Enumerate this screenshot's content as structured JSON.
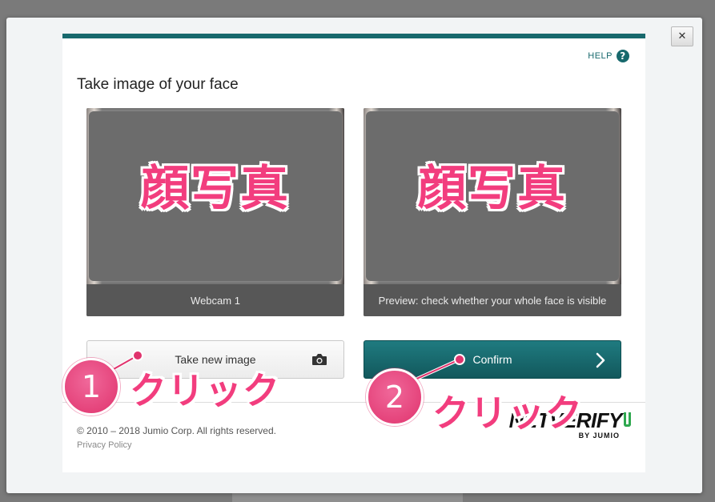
{
  "modal": {
    "close_label": "✕",
    "help_label": "HELP",
    "help_icon_label": "?",
    "title": "Take image of your face"
  },
  "frames": {
    "left": {
      "overlay_text": "顔写真",
      "caption": "Webcam 1"
    },
    "right": {
      "overlay_text": "顔写真",
      "caption": "Preview: check whether your whole face is visible"
    }
  },
  "buttons": {
    "take_new_image": "Take new image",
    "confirm": "Confirm"
  },
  "footer": {
    "copyright": "© 2010 – 2018 Jumio Corp. All rights reserved.",
    "privacy_policy": "Privacy Policy",
    "brand_name": "NETVERIFY",
    "brand_sub": "BY JUMIO"
  },
  "annotations": {
    "step1_number": "1",
    "step1_label": "クリック",
    "step2_number": "2",
    "step2_label": "クリック"
  },
  "colors": {
    "accent": "#18696d",
    "annotation_pink": "#f23d7e",
    "brand_green": "#2fa84f"
  },
  "icons": {
    "close": "close-icon",
    "help": "help-icon",
    "camera": "camera-icon",
    "chevron": "chevron-right-icon"
  }
}
